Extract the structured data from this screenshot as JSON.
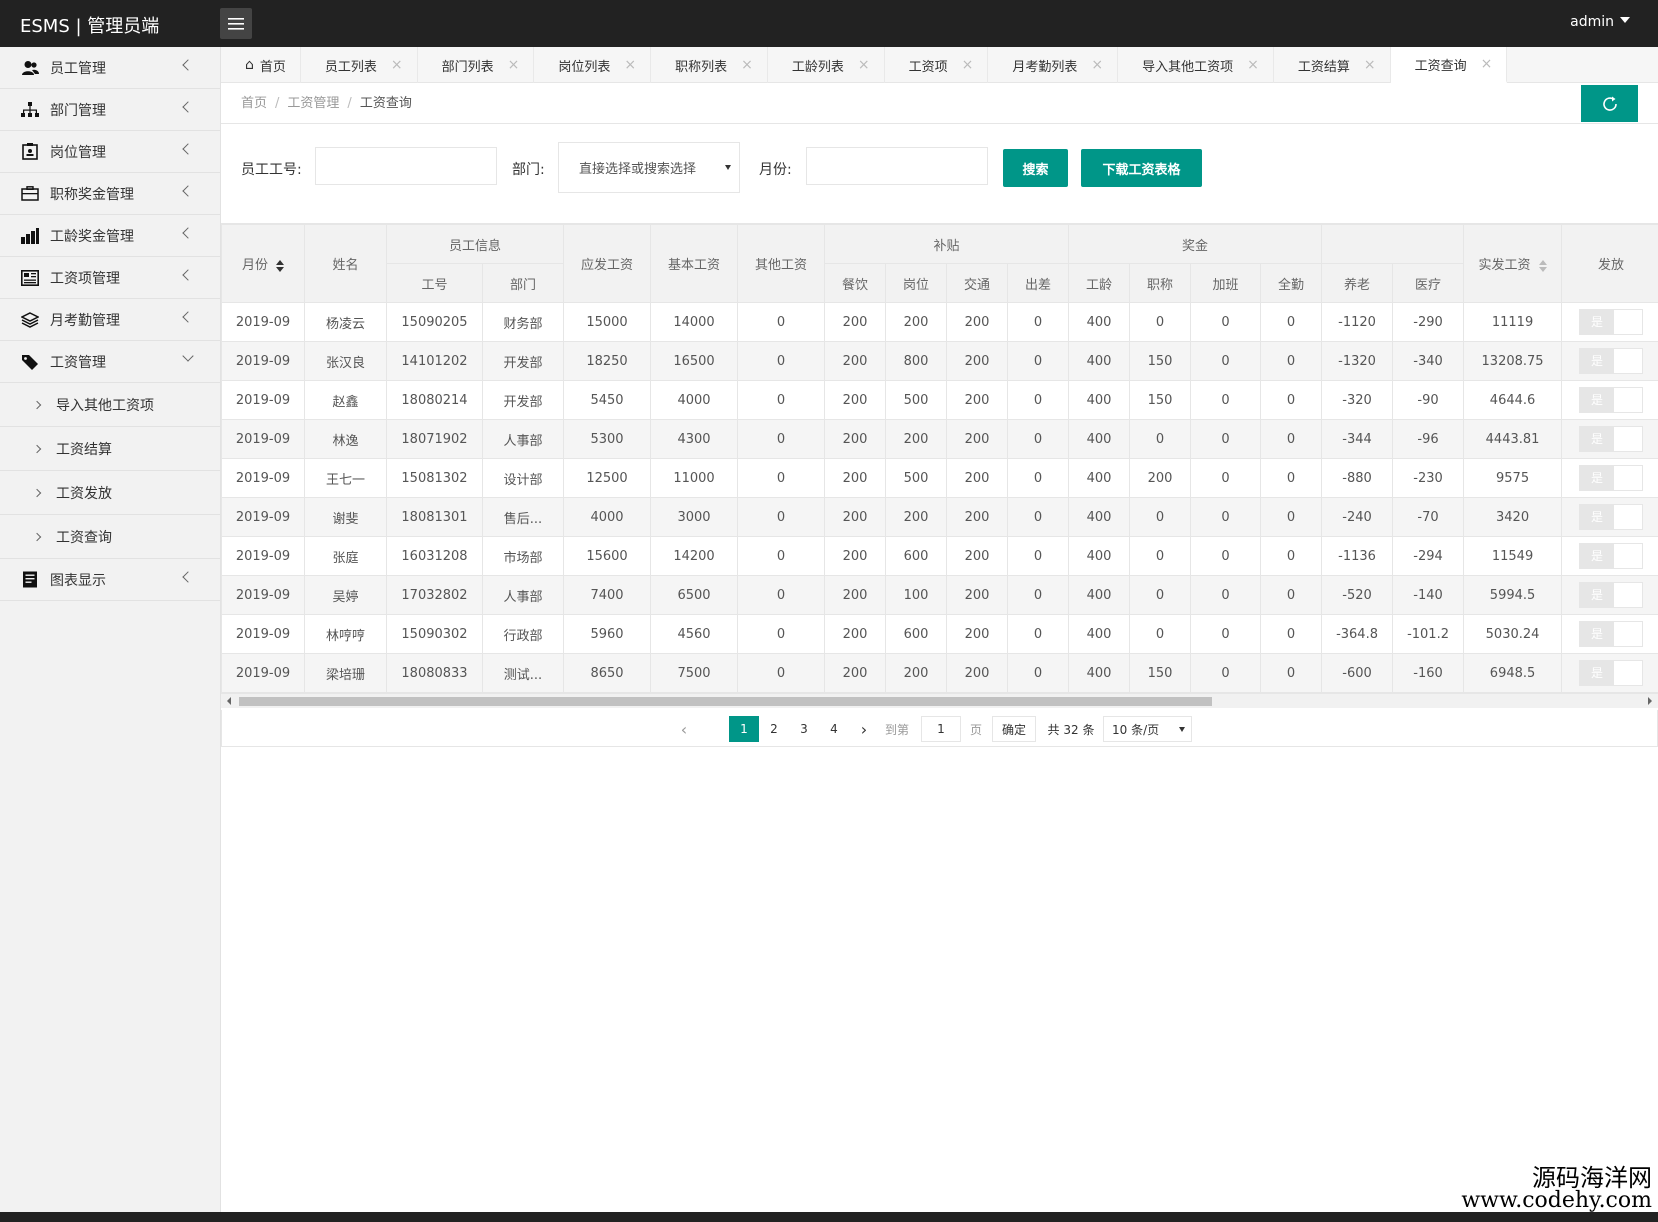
{
  "header": {
    "logo": "ESMS | 管理员端",
    "user": "admin"
  },
  "sidebar": {
    "items": [
      {
        "label": "员工管理",
        "icon": "users-icon"
      },
      {
        "label": "部门管理",
        "icon": "sitemap-icon"
      },
      {
        "label": "岗位管理",
        "icon": "id-card-icon"
      },
      {
        "label": "职称奖金管理",
        "icon": "briefcase-icon"
      },
      {
        "label": "工龄奖金管理",
        "icon": "bar-chart-icon"
      },
      {
        "label": "工资项管理",
        "icon": "newspaper-icon"
      },
      {
        "label": "月考勤管理",
        "icon": "layers-icon"
      },
      {
        "label": "工资管理",
        "icon": "tag-icon"
      }
    ],
    "sub_items": [
      "导入其他工资项",
      "工资结算",
      "工资发放",
      "工资查询"
    ],
    "last_item": {
      "label": "图表显示",
      "icon": "report-icon"
    }
  },
  "tabs": [
    "首页",
    "员工列表",
    "部门列表",
    "岗位列表",
    "职称列表",
    "工龄列表",
    "工资项",
    "月考勤列表",
    "导入其他工资项",
    "工资结算",
    "工资查询"
  ],
  "breadcrumb": [
    "首页",
    "工资管理",
    "工资查询"
  ],
  "breadcrumb_sep": "/",
  "form": {
    "emp_label": "员工工号:",
    "dept_label": "部门:",
    "dept_placeholder": "直接选择或搜索选择",
    "month_label": "月份:",
    "search_btn": "搜索",
    "download_btn": "下载工资表格"
  },
  "table": {
    "h_month": "月份",
    "h_name": "姓名",
    "h_empinfo": "员工信息",
    "h_id": "工号",
    "h_dept": "部门",
    "h_gross": "应发工资",
    "h_base": "基本工资",
    "h_other": "其他工资",
    "h_subsidy": "补贴",
    "h_meal": "餐饮",
    "h_post": "岗位",
    "h_traffic": "交通",
    "h_trip": "出差",
    "h_bonus": "奖金",
    "h_seniority": "工龄",
    "h_title": "职称",
    "h_overtime": "加班",
    "h_attend": "全勤",
    "h_pension": "养老",
    "h_medical": "医疗",
    "h_net": "实发工资",
    "h_issue": "发放",
    "switch_label": "是",
    "rows": [
      [
        "2019-09",
        "杨凌云",
        "15090205",
        "财务部",
        "15000",
        "14000",
        "0",
        "200",
        "200",
        "200",
        "0",
        "400",
        "0",
        "0",
        "0",
        "-1120",
        "-290",
        "11119"
      ],
      [
        "2019-09",
        "张汉良",
        "14101202",
        "开发部",
        "18250",
        "16500",
        "0",
        "200",
        "800",
        "200",
        "0",
        "400",
        "150",
        "0",
        "0",
        "-1320",
        "-340",
        "13208.75"
      ],
      [
        "2019-09",
        "赵鑫",
        "18080214",
        "开发部",
        "5450",
        "4000",
        "0",
        "200",
        "500",
        "200",
        "0",
        "400",
        "150",
        "0",
        "0",
        "-320",
        "-90",
        "4644.6"
      ],
      [
        "2019-09",
        "林逸",
        "18071902",
        "人事部",
        "5300",
        "4300",
        "0",
        "200",
        "200",
        "200",
        "0",
        "400",
        "0",
        "0",
        "0",
        "-344",
        "-96",
        "4443.81"
      ],
      [
        "2019-09",
        "王七一",
        "15081302",
        "设计部",
        "12500",
        "11000",
        "0",
        "200",
        "500",
        "200",
        "0",
        "400",
        "200",
        "0",
        "0",
        "-880",
        "-230",
        "9575"
      ],
      [
        "2019-09",
        "谢斐",
        "18081301",
        "售后...",
        "4000",
        "3000",
        "0",
        "200",
        "200",
        "200",
        "0",
        "400",
        "0",
        "0",
        "0",
        "-240",
        "-70",
        "3420"
      ],
      [
        "2019-09",
        "张庭",
        "16031208",
        "市场部",
        "15600",
        "14200",
        "0",
        "200",
        "600",
        "200",
        "0",
        "400",
        "0",
        "0",
        "0",
        "-1136",
        "-294",
        "11549"
      ],
      [
        "2019-09",
        "吴婷",
        "17032802",
        "人事部",
        "7400",
        "6500",
        "0",
        "200",
        "100",
        "200",
        "0",
        "400",
        "0",
        "0",
        "0",
        "-520",
        "-140",
        "5994.5"
      ],
      [
        "2019-09",
        "林哼哼",
        "15090302",
        "行政部",
        "5960",
        "4560",
        "0",
        "200",
        "600",
        "200",
        "0",
        "400",
        "0",
        "0",
        "0",
        "-364.8",
        "-101.2",
        "5030.24"
      ],
      [
        "2019-09",
        "梁培珊",
        "18080833",
        "测试...",
        "8650",
        "7500",
        "0",
        "200",
        "200",
        "200",
        "0",
        "400",
        "150",
        "0",
        "0",
        "-600",
        "-160",
        "6948.5"
      ]
    ]
  },
  "pager": {
    "pages": [
      "1",
      "2",
      "3",
      "4"
    ],
    "goto_label": "到第",
    "goto_value": "1",
    "page_unit": "页",
    "confirm": "确定",
    "total": "共 32 条",
    "per_page": "10 条/页"
  },
  "watermark": {
    "line1": "源码海洋网",
    "line2": "www.codehy.com"
  },
  "colors": {
    "accent": "#009688",
    "topbar": "#222222",
    "sidebar": "#f2f2f2"
  }
}
